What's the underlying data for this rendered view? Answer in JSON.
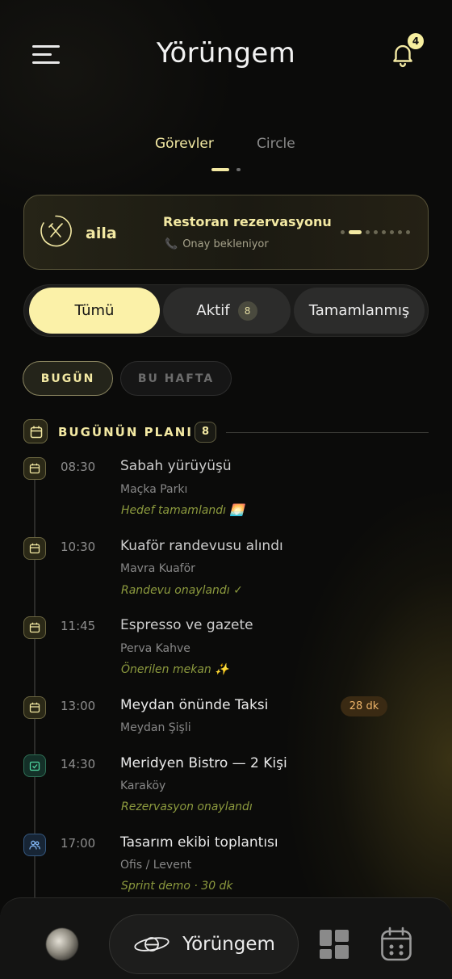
{
  "header": {
    "title": "Yörüngem",
    "notification_count": "4",
    "menu_icon": "hamburger-menu-icon",
    "bell_icon": "bell-icon"
  },
  "top_tabs": [
    {
      "label": "Görevler",
      "active": true
    },
    {
      "label": "Circle",
      "active": false
    }
  ],
  "banner": {
    "brand": "aila",
    "icon": "fork-knife-icon",
    "title": "Restoran rezervasyonu",
    "status": "Onay bekleniyor",
    "status_icon": "phone-icon",
    "page_count": 8,
    "page_active": 1
  },
  "filters": {
    "all": "Tümü",
    "active": "Aktif",
    "active_count": "8",
    "done": "Tamamlanmış"
  },
  "chips": {
    "today": "BUGÜN",
    "week": "BU HAFTA"
  },
  "section": {
    "title": "BUGÜNÜN PLANI",
    "count": "8"
  },
  "timeline": [
    {
      "time": "08:30",
      "title": "Sabah yürüyüşü",
      "subtitle": "Maçka Parkı",
      "note": "Hedef tamamlandı 🌅",
      "icon": "calendar-icon"
    },
    {
      "time": "10:30",
      "title": "Kuaför randevusu alındı",
      "subtitle": "Mavra Kuaför",
      "note": "Randevu onaylandı ✓",
      "icon": "calendar-icon"
    },
    {
      "time": "11:45",
      "title": "Espresso ve gazete",
      "subtitle": "Perva Kahve",
      "note": "Önerilen mekan ✨",
      "icon": "calendar-icon"
    },
    {
      "time": "13:00",
      "title": "Meydan önünde Taksi",
      "subtitle": "Meydan Şişli",
      "badge": "28 dk",
      "icon": "calendar-icon"
    },
    {
      "time": "14:30",
      "title": "Meridyen Bistro — 2 Kişi",
      "subtitle": "Karaköy",
      "note": "Rezervasyon onaylandı",
      "icon": "checkbox-icon"
    },
    {
      "time": "17:00",
      "title": "Tasarım ekibi toplantısı",
      "subtitle": "Ofis / Levent",
      "note": "Sprint demo · 30 dk",
      "icon": "people-icon"
    }
  ],
  "bottom_nav": {
    "center_label": "Yörüngem",
    "center_icon": "orbit-planet-icon",
    "left": "avatar",
    "grid_icon": "grid-icon",
    "calendar_icon": "calendar-icon"
  },
  "colors": {
    "accent": "#f3e9a3",
    "background": "#0b0b0a",
    "note_green": "#8c9a3e",
    "badge_orange": "#eeb56a"
  }
}
